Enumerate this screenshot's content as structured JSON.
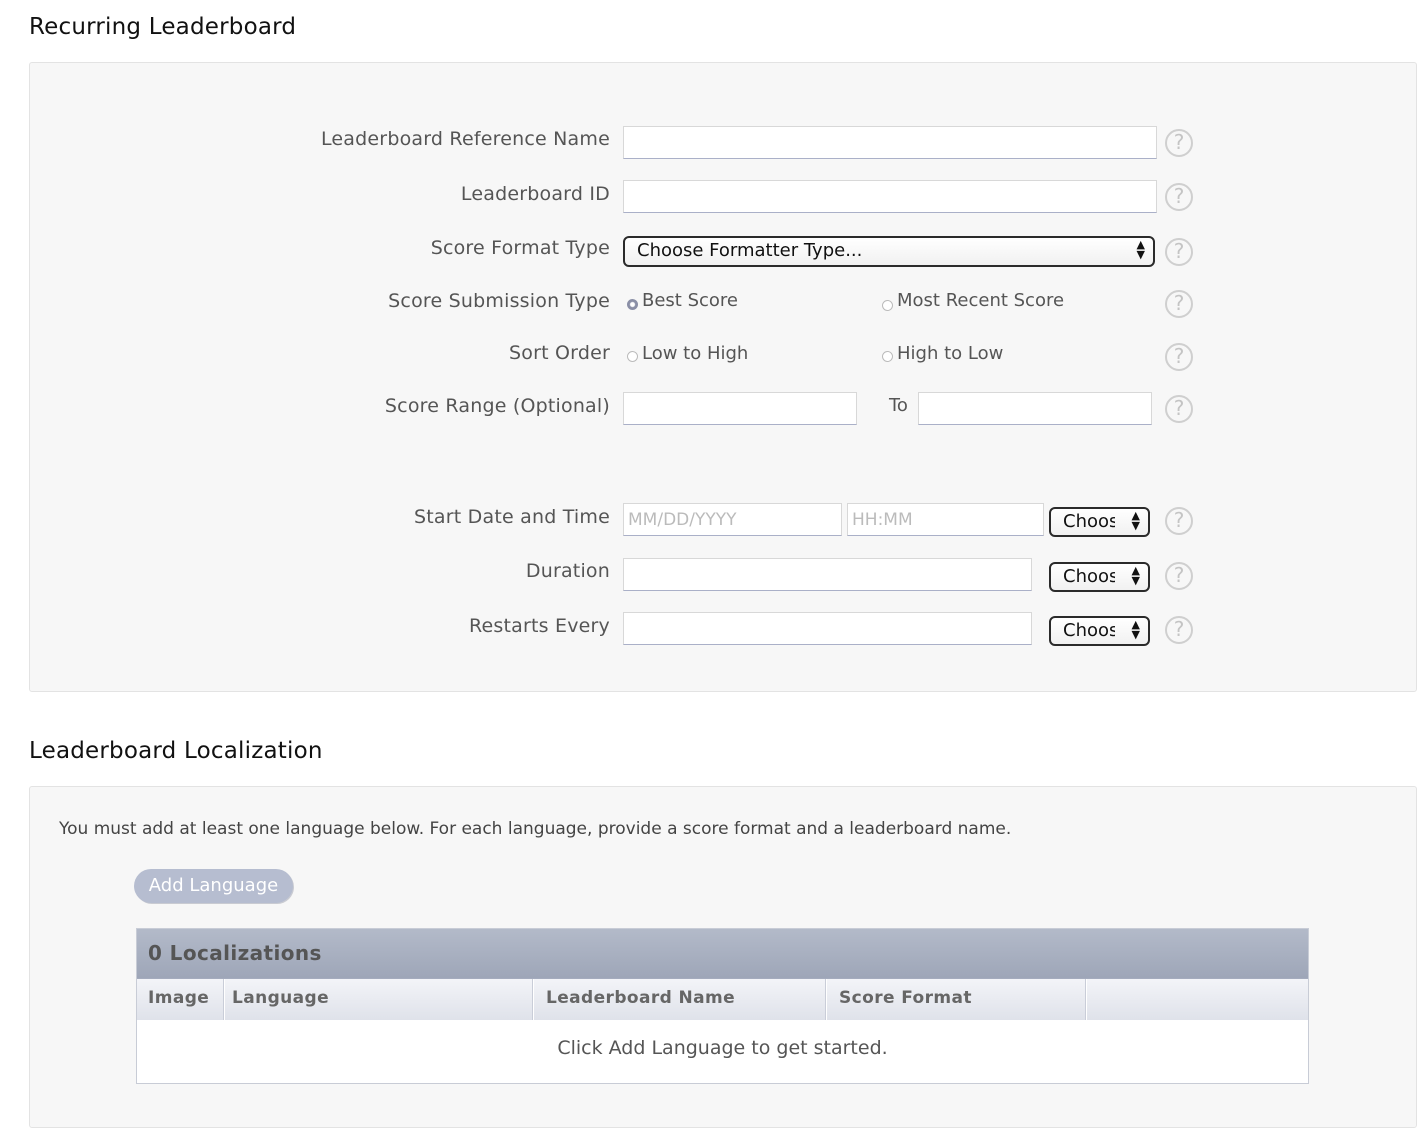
{
  "recurring": {
    "title": "Recurring Leaderboard",
    "reference_name_label": "Leaderboard Reference Name",
    "id_label": "Leaderboard ID",
    "score_format_label": "Score Format Type",
    "score_format_value": "Choose Formatter Type...",
    "submission_label": "Score Submission Type",
    "submission_options": [
      "Best Score",
      "Most Recent Score"
    ],
    "submission_selected": "Best Score",
    "sort_label": "Sort Order",
    "sort_options": [
      "Low to High",
      "High to Low"
    ],
    "range_label": "Score Range (Optional)",
    "range_to": "To",
    "start_label": "Start Date and Time",
    "date_placeholder": "MM/DD/YYYY",
    "time_placeholder": "HH:MM",
    "choose_short": "Choose",
    "duration_label": "Duration",
    "restarts_label": "Restarts Every",
    "help_glyph": "?"
  },
  "localization": {
    "title": "Leaderboard Localization",
    "instruction": "You must add at least one language below. For each language, provide a score format and a leaderboard name.",
    "add_button": "Add Language",
    "table_title": "0 Localizations",
    "columns": [
      "Image",
      "Language",
      "Leaderboard Name",
      "Score Format"
    ],
    "empty_message": "Click Add Language to get started."
  }
}
